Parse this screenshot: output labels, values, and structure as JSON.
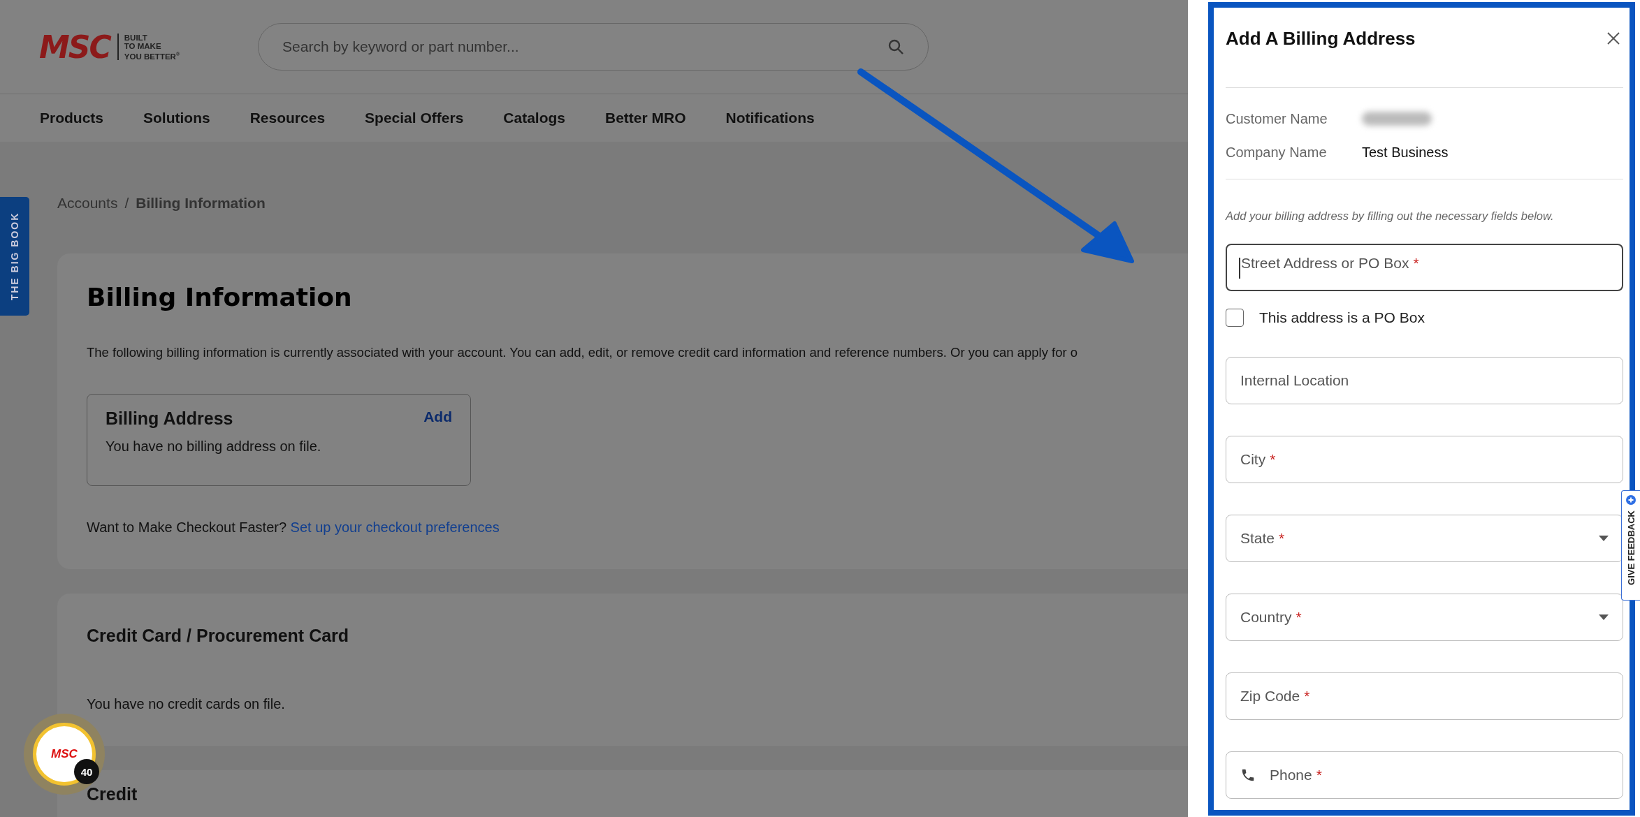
{
  "header": {
    "logo": {
      "brand": "MSC",
      "tagline": [
        "BUILT",
        "TO MAKE",
        "YOU BETTER$^{®}$"
      ]
    },
    "search": {
      "placeholder": "Search by keyword or part number..."
    }
  },
  "nav": [
    {
      "label": "Products"
    },
    {
      "label": "Solutions"
    },
    {
      "label": "Resources"
    },
    {
      "label": "Special Offers"
    },
    {
      "label": "Catalogs"
    },
    {
      "label": "Better MRO"
    },
    {
      "label": "Notifications"
    }
  ],
  "side_tab": {
    "label": "THE BIG BOOK"
  },
  "breadcrumb": {
    "separator": "/",
    "items": [
      {
        "label": "Accounts",
        "current": false
      },
      {
        "label": "Billing Information",
        "current": true
      }
    ]
  },
  "billing": {
    "title": "Billing Information",
    "intro": "The following billing information is currently associated with your account. You can add, edit, or remove credit card information and reference numbers. Or you can apply for o",
    "address_card": {
      "title": "Billing Address",
      "action": "Add",
      "text": "You have no billing address on file."
    },
    "checkout": {
      "text": "Want to Make Checkout Faster?",
      "link": "Set up your checkout preferences"
    }
  },
  "credit_card": {
    "title": "Credit Card / Procurement Card",
    "text": "You have no credit cards on file."
  },
  "credit": {
    "title": "Credit"
  },
  "drawer": {
    "title": "Add A Billing Address",
    "info": [
      {
        "label": "Customer Name",
        "redacted": true
      },
      {
        "label": "Company Name",
        "value": "Test Business",
        "redacted": false
      }
    ],
    "hint": "Add your billing address by filling out the necessary fields below.",
    "fields": [
      {
        "kind": "text",
        "placeholder": "Street Address or PO Box",
        "required_mark": "*",
        "focused": true
      },
      {
        "kind": "checkbox",
        "label": "This address is a PO Box",
        "checked": false
      },
      {
        "kind": "text",
        "placeholder": "Internal Location",
        "focused": false
      },
      {
        "kind": "text",
        "placeholder": "City",
        "required_mark": "*",
        "focused": false
      },
      {
        "kind": "select",
        "placeholder": "State",
        "required_mark": "*",
        "focused": false
      },
      {
        "kind": "select",
        "placeholder": "Country",
        "required_mark": "*",
        "focused": false
      },
      {
        "kind": "text",
        "placeholder": "Zip Code",
        "required_mark": "*",
        "focused": false
      },
      {
        "kind": "phone",
        "placeholder": "Phone",
        "required_mark": "*",
        "focused": false
      }
    ]
  },
  "feedback_tab": {
    "label": "GIVE FEEDBACK"
  },
  "rewards_badge": {
    "brand": "MSC",
    "count": "40"
  }
}
